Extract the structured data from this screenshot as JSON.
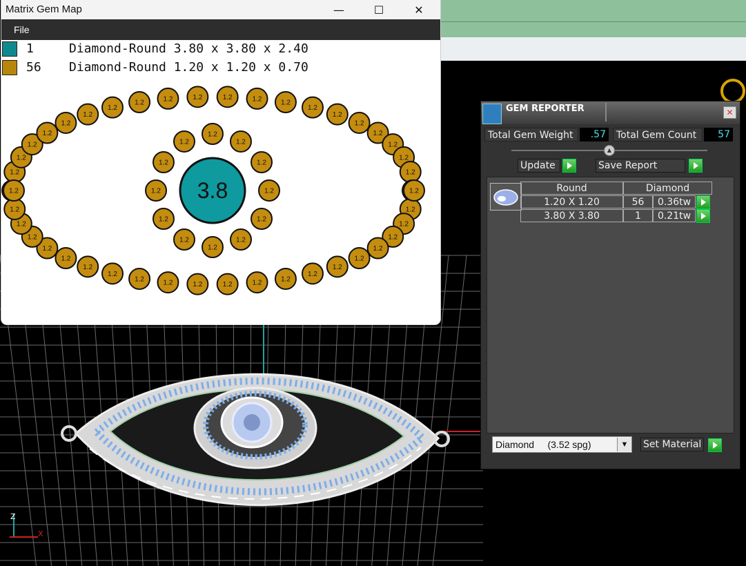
{
  "gem_map": {
    "title": "Matrix Gem Map",
    "controls": {
      "minimize": "—",
      "maximize": "☐",
      "close": "✕"
    },
    "menu": {
      "file": "File"
    },
    "legend": [
      {
        "count": "1",
        "description": "Diamond-Round 3.80 x 3.80 x 2.40",
        "color": "#0e8a8e"
      },
      {
        "count": "56",
        "description": "Diamond-Round 1.20 x 1.20 x 0.70",
        "color": "#b8860b"
      }
    ],
    "center_stone_label": "3.8",
    "small_stone_label": "1.2",
    "center_color": "#0e9a9e",
    "small_color": "#c48d0f"
  },
  "reporter": {
    "title": "GEM REPORTER",
    "total_weight_label": "Total Gem Weight",
    "total_weight_value": ".57",
    "total_count_label": "Total Gem Count",
    "total_count_value": "57",
    "update_label": "Update",
    "save_report_label": "Save Report",
    "table_headers": [
      "Round",
      "Diamond"
    ],
    "rows": [
      {
        "size": "1.20 X 1.20",
        "count": "56",
        "weight": "0.36tw"
      },
      {
        "size": "3.80 X 3.80",
        "count": "1",
        "weight": "0.21tw"
      }
    ],
    "material_value": "Diamond     (3.52 spg)",
    "set_material_label": "Set Material"
  },
  "viewport": {
    "axis_z": "Z",
    "axis_x": "X"
  }
}
